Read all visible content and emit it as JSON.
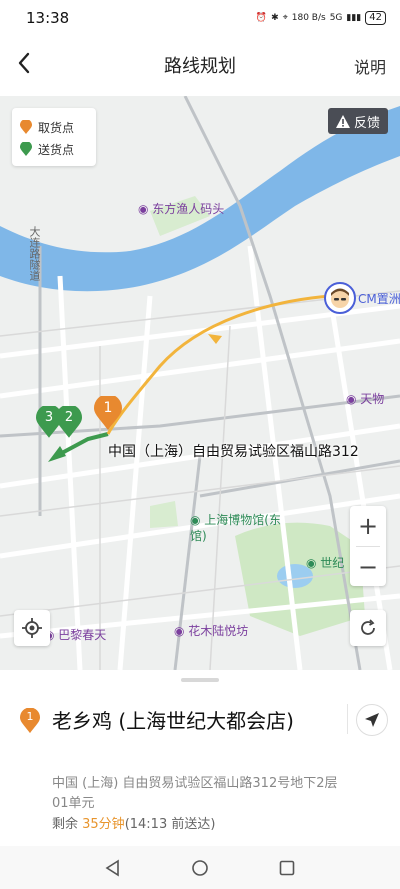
{
  "status_bar": {
    "time": "13:38",
    "speed": "180 B/s",
    "network": "5G",
    "battery": "42"
  },
  "header": {
    "title": "路线规划",
    "explain": "说明"
  },
  "legend": {
    "pickup": "取货点",
    "dropoff": "送货点"
  },
  "feedback_label": "反馈",
  "map_labels": {
    "poi1": "东方渔人码头",
    "tunnel": "大连路隧道",
    "cm": "CM置洲",
    "tianwu": "天物",
    "museum": "上海博物馆(东馆)",
    "shiji": "世纪",
    "paris": "巴黎春天",
    "huamu": "花木陆悦坊",
    "address_on_map": "中国（上海）自由贸易试验区福山路312",
    "marker_pickup": "1",
    "marker_dropoff_a": "3",
    "marker_dropoff_b": "2"
  },
  "zoom": {
    "plus": "+",
    "minus": "−"
  },
  "order": {
    "index": "1",
    "store_name": "老乡鸡 (上海世纪大都会店)",
    "address": "中国 (上海) 自由贸易试验区福山路312号地下2层01单元",
    "remain_prefix": "剩余 ",
    "remain_minutes": "35分钟",
    "remain_suffix": "(14:13 前送达)"
  },
  "colors": {
    "pickup": "#e8892f",
    "dropoff": "#3d9a4e",
    "route": "#f2b43c",
    "river": "#7fb7e8"
  },
  "icons": [
    "back-icon",
    "warning-icon",
    "locate-icon",
    "refresh-icon",
    "navigate-icon",
    "nav-back-icon",
    "nav-home-icon",
    "nav-recent-icon"
  ]
}
